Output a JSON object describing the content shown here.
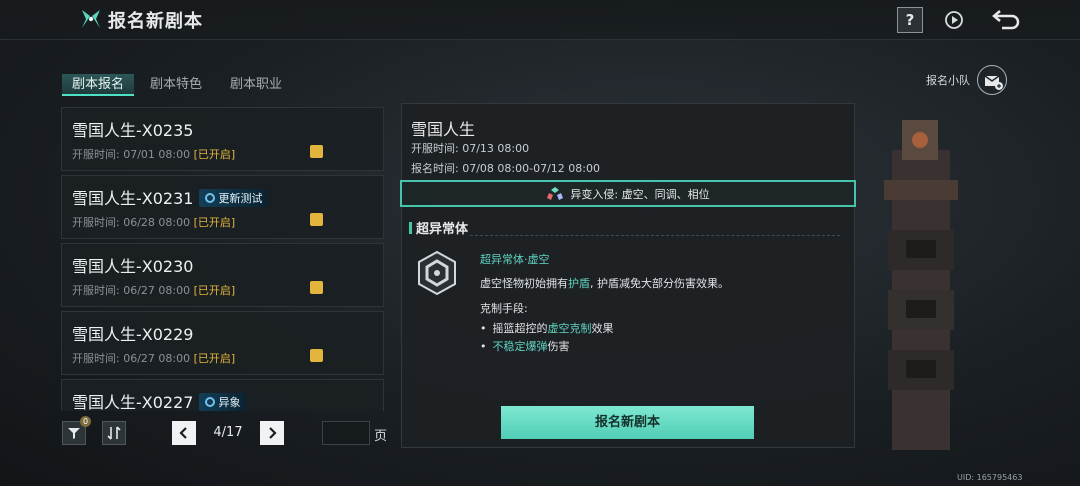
{
  "header": {
    "title": "报名新剧本",
    "help_label": "?"
  },
  "tabs": [
    {
      "label": "剧本报名",
      "active": true
    },
    {
      "label": "剧本特色",
      "active": false
    },
    {
      "label": "剧本职业",
      "active": false
    }
  ],
  "team": {
    "label": "报名小队"
  },
  "server_list": [
    {
      "name": "雪国人生-X0235",
      "time": "开服时间: 07/01 08:00",
      "status": "[已开启]",
      "tag": ""
    },
    {
      "name": "雪国人生-X0231",
      "time": "开服时间: 06/28 08:00",
      "status": "[已开启]",
      "tag": "更新测试"
    },
    {
      "name": "雪国人生-X0230",
      "time": "开服时间: 06/27 08:00",
      "status": "[已开启]",
      "tag": ""
    },
    {
      "name": "雪国人生-X0229",
      "time": "开服时间: 06/27 08:00",
      "status": "[已开启]",
      "tag": ""
    },
    {
      "name": "雪国人生-X0227",
      "time": "",
      "status": "",
      "tag": "异象"
    }
  ],
  "pager": {
    "filter_badge": "0",
    "page": "4/17",
    "unit": "页"
  },
  "detail": {
    "title": "雪国人生",
    "open_time": "开服时间: 07/13 08:00",
    "reg_time": "报名时间: 07/08 08:00-07/12 08:00",
    "mutation": "异变入侵: 虚空、同调、相位",
    "section_title": "超异常体",
    "mechanic_name": "超异常体·虚空",
    "desc_a": "虚空怪物初始拥有",
    "desc_hl": "护盾",
    "desc_b": ", 护盾减免大部分伤害效果。",
    "counter_label": "克制手段:",
    "b1_a": "摇篮超控的",
    "b1_hl": "虚空克制",
    "b1_b": "效果",
    "b2_hl": "不稳定爆弹",
    "b2_b": "伤害",
    "register_label": "报名新剧本"
  },
  "uid": "UID: 165795463",
  "colors": {
    "accent": "#46c5ac",
    "open_status": "#e2b53d",
    "button": "#6ddcc5"
  }
}
